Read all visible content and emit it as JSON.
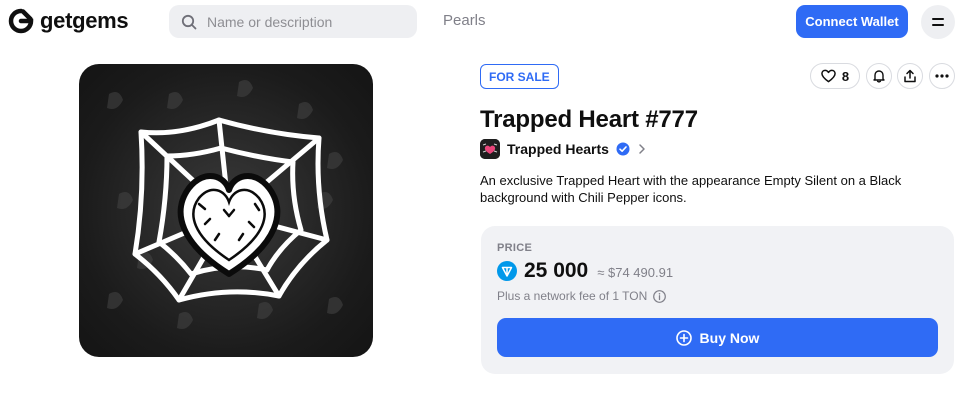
{
  "header": {
    "logo_text": "getgems",
    "search_placeholder": "Name or description",
    "nav_link": "Pearls",
    "connect_label": "Connect Wallet"
  },
  "nft": {
    "status_badge": "FOR SALE",
    "like_count": "8",
    "title": "Trapped Heart #777",
    "collection_name": "Trapped Hearts",
    "description": "An exclusive Trapped Heart with the appearance Empty Silent on a Black background with Chili Pepper icons."
  },
  "price": {
    "label": "PRICE",
    "value": "25 000",
    "usd": "≈ $74 490.91",
    "fee": "Plus a network fee of 1 TON",
    "buy_label": "Buy Now"
  },
  "colors": {
    "accent": "#2f6bf5",
    "ton": "#0098ea",
    "card_bg": "#f1f2f5"
  },
  "icons": [
    "getgems-logo-icon",
    "search-icon",
    "menu-icon",
    "heart-icon",
    "bell-icon",
    "share-icon",
    "more-icon",
    "verified-icon",
    "chevron-right-icon",
    "ton-icon",
    "info-icon",
    "plus-circle-icon"
  ]
}
